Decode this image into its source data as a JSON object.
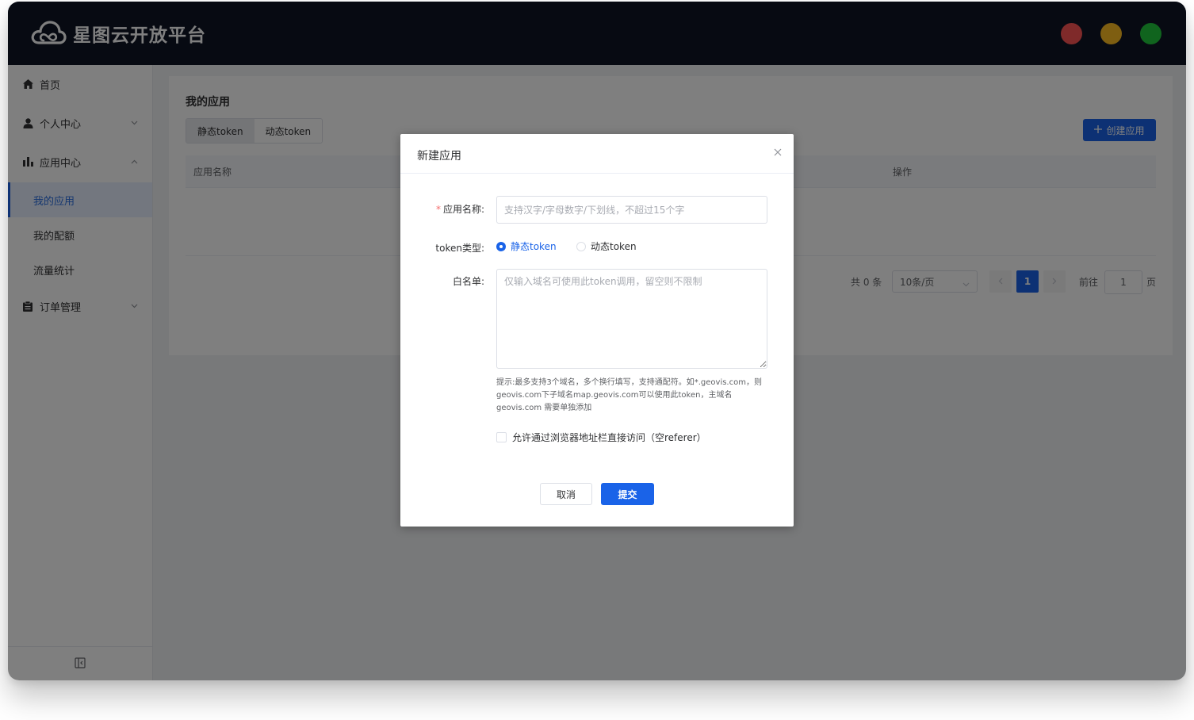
{
  "header": {
    "brand": "星图云开放平台"
  },
  "sidebar": {
    "items": [
      {
        "label": "首页",
        "icon": "home-icon"
      },
      {
        "label": "个人中心",
        "icon": "user-icon",
        "arrow": "chevron-down-icon"
      },
      {
        "label": "应用中心",
        "icon": "bar-chart-icon",
        "arrow": "chevron-up-icon"
      },
      {
        "label": "订单管理",
        "icon": "clipboard-icon",
        "arrow": "chevron-down-icon"
      }
    ],
    "sub_items": [
      {
        "label": "我的应用",
        "active": true
      },
      {
        "label": "我的配额",
        "active": false
      },
      {
        "label": "流量统计",
        "active": false
      }
    ],
    "collapse_icon": "sidebar-collapse-icon"
  },
  "main": {
    "title": "我的应用",
    "tabs": [
      "静态token",
      "动态token"
    ],
    "create_button": "创建应用",
    "table": {
      "columns": [
        "应用名称",
        "操作"
      ]
    },
    "pagination": {
      "total": "共 0 条",
      "page_size": "10条/页",
      "current_page": "1",
      "goto_label": "前往",
      "goto_value": "1",
      "page_suffix": "页"
    }
  },
  "dialog": {
    "title": "新建应用",
    "name_label": "应用名称:",
    "name_placeholder": "支持汉字/字母数字/下划线，不超过15个字",
    "token_type_label": "token类型:",
    "token_options": [
      "静态token",
      "动态token"
    ],
    "token_selected": "静态token",
    "whitelist_label": "白名单:",
    "whitelist_placeholder": "仅输入域名可使用此token调用，留空则不限制",
    "hint": "提示:最多支持3个域名，多个换行填写，支持通配符。如*.geovis.com，则geovis.com下子域名map.geovis.com可以使用此token，主域名geovis.com 需要单独添加",
    "checkbox_label": "允许通过浏览器地址栏直接访问（空referer）",
    "cancel_button": "取消",
    "submit_button": "提交"
  },
  "colors": {
    "header_bg": "#0e1525",
    "primary": "#1a63e8",
    "required": "#f56c6c",
    "traffic_red": "#fe5454",
    "traffic_yellow": "#fdbd22",
    "traffic_green": "#20c83c"
  }
}
